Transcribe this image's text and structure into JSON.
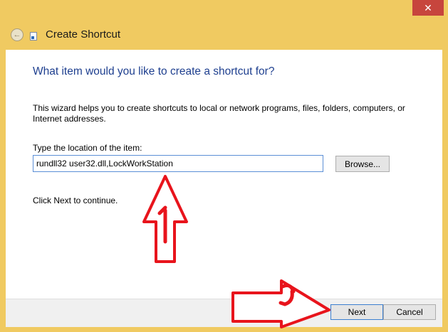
{
  "window": {
    "title": "Create Shortcut",
    "close_glyph": "✕",
    "frame_color": "#f0ca61"
  },
  "main": {
    "heading": "What item would you like to create a shortcut for?",
    "description": "This wizard helps you to create shortcuts to local or network programs, files, folders, computers, or Internet addresses.",
    "location_label": "Type the location of the item:",
    "location_value": "rundll32 user32.dll,LockWorkStation",
    "browse_label": "Browse...",
    "continue_text": "Click Next to continue."
  },
  "footer": {
    "next_label": "Next",
    "cancel_label": "Cancel"
  },
  "icons": {
    "back": "back-arrow-icon",
    "shortcut": "shortcut-icon",
    "close": "close-icon"
  },
  "annotation_color": "#e8141c"
}
